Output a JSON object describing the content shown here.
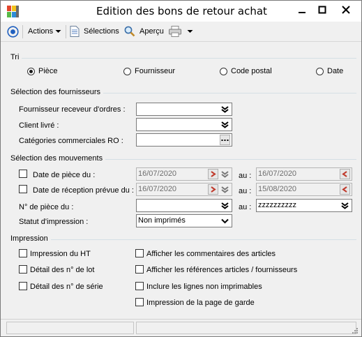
{
  "window": {
    "title": "Edition des bons de retour achat"
  },
  "toolbar": {
    "actions_label": "Actions",
    "selections_label": "Sélections",
    "apercu_label": "Aperçu"
  },
  "tri": {
    "title": "Tri",
    "options": [
      "Pièce",
      "Fournisseur",
      "Code postal",
      "Date"
    ],
    "selected": "Pièce"
  },
  "fournisseurs": {
    "title": "Sélection des fournisseurs",
    "fournisseur_label": "Fournisseur receveur d'ordres :",
    "fournisseur_value": "",
    "client_label": "Client livré :",
    "client_value": "",
    "categories_label": "Catégories commerciales RO :",
    "categories_value": ""
  },
  "mouvements": {
    "title": "Sélection des mouvements",
    "date_piece_label": "Date de pièce du :",
    "date_piece_from": "16/07/2020",
    "date_piece_to": "16/07/2020",
    "date_reception_label": "Date de réception prévue du :",
    "date_reception_from": "16/07/2020",
    "date_reception_to": "15/08/2020",
    "au_label": "au :",
    "num_piece_label": "N° de pièce du :",
    "num_piece_from": "",
    "num_piece_to": "zzzzzzzzzz",
    "statut_label": "Statut d'impression :",
    "statut_value": "Non imprimés"
  },
  "impression": {
    "title": "Impression",
    "left": [
      "Impression du HT",
      "Détail des n° de lot",
      "Détail des n° de série"
    ],
    "right": [
      "Afficher les commentaires des articles",
      "Afficher les références articles / fournisseurs",
      "Inclure les lignes non imprimables",
      "Impression de la page de garde"
    ]
  },
  "colors": {
    "accent": "#1f5fbf",
    "field_border": "#7a7a7a",
    "group_line": "#d5dfe5"
  }
}
